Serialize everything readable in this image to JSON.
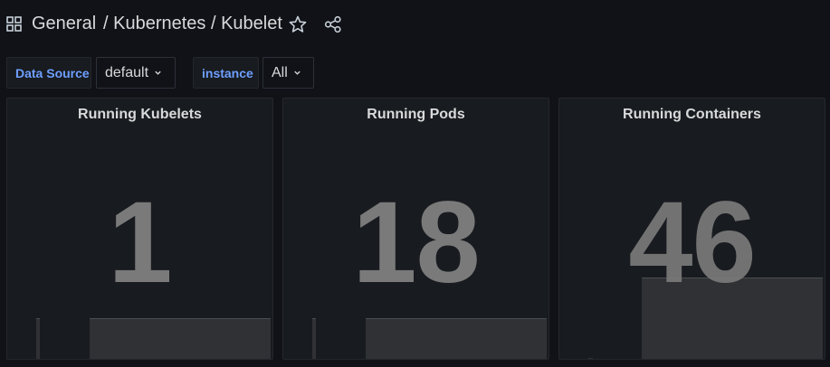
{
  "header": {
    "breadcrumb_general": "General",
    "breadcrumb_rest": "/ Kubernetes / Kubelet",
    "icons": [
      "apps-icon",
      "star-icon",
      "share-icon"
    ]
  },
  "variables": [
    {
      "label": "Data Source",
      "value": "default"
    },
    {
      "label": "instance",
      "value": "All"
    }
  ],
  "panels": [
    {
      "title": "Running Kubelets",
      "value": "1"
    },
    {
      "title": "Running Pods",
      "value": "18"
    },
    {
      "title": "Running Containers",
      "value": "46"
    }
  ],
  "colors": {
    "background": "#111217",
    "panel": "#181b1f",
    "variable_label": "#6e9fff",
    "stat_value": "#7a7a7a",
    "sparkline_fill": "#2f3134"
  }
}
